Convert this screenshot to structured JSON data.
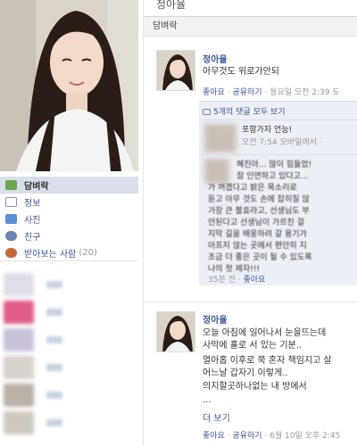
{
  "header": {
    "top_title": "정아율"
  },
  "sidebar": {
    "items": [
      {
        "label": "담벼락",
        "icon": "wall-icon",
        "color": "#6aa84f"
      },
      {
        "label": "정보",
        "icon": "info-icon",
        "color": "#7a93c6"
      },
      {
        "label": "사진",
        "icon": "photos-icon",
        "color": "#5b8fd6"
      },
      {
        "label": "친구",
        "icon": "friends-icon",
        "color": "#6d84b4"
      },
      {
        "label": "받아보는 사람",
        "count": "(20)",
        "icon": "subscribers-icon",
        "color": "#c66a3e"
      }
    ]
  },
  "wall": {
    "section_label": "담벼락"
  },
  "post1": {
    "author": "정아율",
    "text": "아무것도 위로가안되",
    "meta": {
      "like": "좋아요",
      "share": "공유하기",
      "time": "· 월요일 오전 2:39 도"
    },
    "comments_link": "5개의 댓글 모두 보기",
    "comment1": {
      "text": "포항가자 언능!",
      "meta": "오전 7:54 모바일에서 ·"
    },
    "comment2": {
      "lines": [
        "혜진아... 많이 힘들었!",
        "참 인연하고 있다고...",
        "가 꺼겠다고 밝은 목소리로",
        "듣고 아무 것도 손에 잡히질 않",
        "가장 큰 불효라고, 선생님도 부",
        "안된다고 선생님이 가르친 걸",
        "지막 길을 배웅하려 갈 용기가",
        "아프지 않는 곳에서 편안히 지",
        "조금 더 좋은 곳이 될 수 있도록",
        "나의 첫 제자!!!"
      ],
      "meta_time": "35분 전",
      "meta_like": "좋아요"
    }
  },
  "post2": {
    "author": "정아율",
    "lines": [
      "오늘 아침에 일어나서 눈을뜨는데",
      "사막에 홀로 서 있는 기분..",
      "열아홉 이후로 쭉 혼자 책임지고 살",
      "어느날 갑자기 이렇게..",
      "의지할곳하나없는 내 방에서",
      "..."
    ],
    "more_link": "더 보기",
    "meta": {
      "like": "좋아요",
      "share": "공유하기",
      "time": "· 6월 10일 오후 2:45"
    }
  },
  "colors": {
    "link": "#3b5998",
    "nav_active": "#d8dfea",
    "comment_bg": "#eceff5"
  }
}
